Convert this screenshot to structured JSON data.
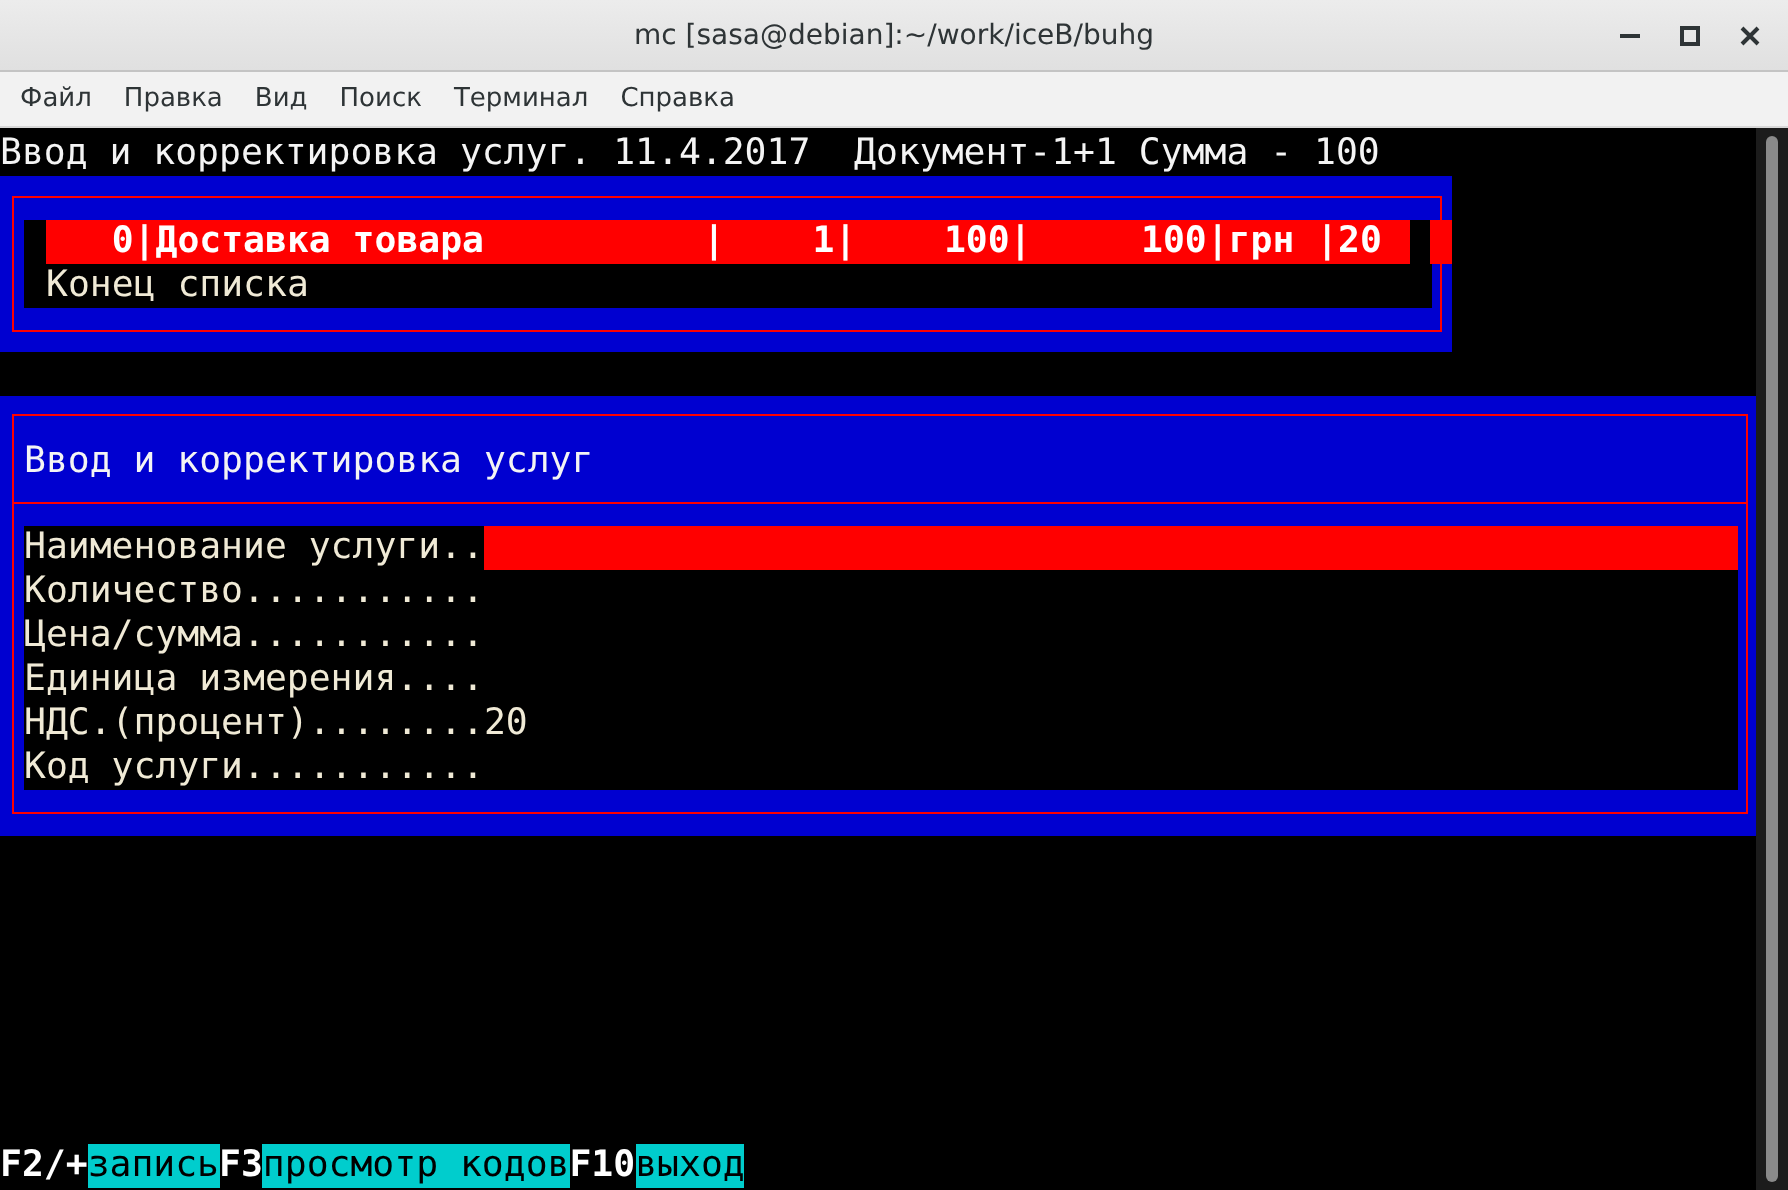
{
  "window": {
    "title": "mc [sasa@debian]:~/work/iceB/buhg"
  },
  "menu": [
    "Файл",
    "Правка",
    "Вид",
    "Поиск",
    "Терминал",
    "Справка"
  ],
  "terminal": {
    "header": "Ввод и корректировка услуг. 11.4.2017  Документ-1+1 Сумма - 100",
    "list": {
      "rows": [
        {
          "text": "   0|Доставка товара          |    1|    100|     100|грн |20 ",
          "selected": true
        },
        {
          "text": "Конец списка",
          "selected": false
        }
      ]
    },
    "form": {
      "title": "Ввод и корректировка услуг",
      "fields": [
        {
          "label": "Наименование услуги..",
          "active": true
        },
        {
          "label": "Количество...........",
          "active": false
        },
        {
          "label": "Цена/сумма...........",
          "active": false
        },
        {
          "label": "Единица измерения....",
          "active": false
        },
        {
          "label": "НДС.(процент)........",
          "value": "20",
          "active": false
        },
        {
          "label": "Код услуги...........",
          "active": false
        }
      ]
    },
    "keys": [
      {
        "key": "F2/+",
        "label": "запись"
      },
      {
        "key": "F3",
        "label": "просмотр кодов"
      },
      {
        "key": "F10",
        "label": "выход"
      }
    ]
  }
}
